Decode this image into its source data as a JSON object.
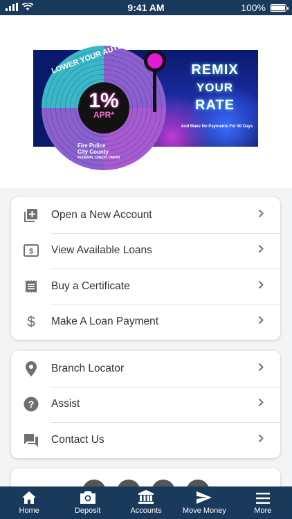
{
  "status_bar": {
    "time": "9:41 AM",
    "battery": "100%",
    "icons": [
      "signal-icon",
      "wifi-icon",
      "battery-icon"
    ]
  },
  "banner": {
    "disc_tagline": "LOWER YOUR AUTO RATE BY",
    "rate": "1%",
    "rate_unit": "APR*",
    "headline_1": "REMIX",
    "headline_2": "YOUR",
    "headline_3": "RATE",
    "subline": "And Make No Payments For 90 Days",
    "brand_line_1": "Fire Police",
    "brand_line_2": "City County",
    "brand_line_3": "FEDERAL CREDIT UNION"
  },
  "primary_menu": [
    {
      "label": "Open a New Account",
      "icon": "add-account-icon"
    },
    {
      "label": "View Available Loans",
      "icon": "money-icon"
    },
    {
      "label": "Buy a Certificate",
      "icon": "certificate-icon"
    },
    {
      "label": "Make A Loan Payment",
      "icon": "dollar-icon"
    }
  ],
  "secondary_menu": [
    {
      "label": "Branch Locator",
      "icon": "location-pin-icon"
    },
    {
      "label": "Assist",
      "icon": "help-icon"
    },
    {
      "label": "Contact Us",
      "icon": "chat-icon"
    }
  ],
  "tab_bar": [
    {
      "label": "Home",
      "icon": "home-icon"
    },
    {
      "label": "Deposit",
      "icon": "camera-icon"
    },
    {
      "label": "Accounts",
      "icon": "bank-icon"
    },
    {
      "label": "Move Money",
      "icon": "send-icon"
    },
    {
      "label": "More",
      "icon": "menu-icon"
    }
  ],
  "colors": {
    "brand_navy": "#1a3a5c",
    "icon_gray": "#707070",
    "text": "#333333"
  }
}
